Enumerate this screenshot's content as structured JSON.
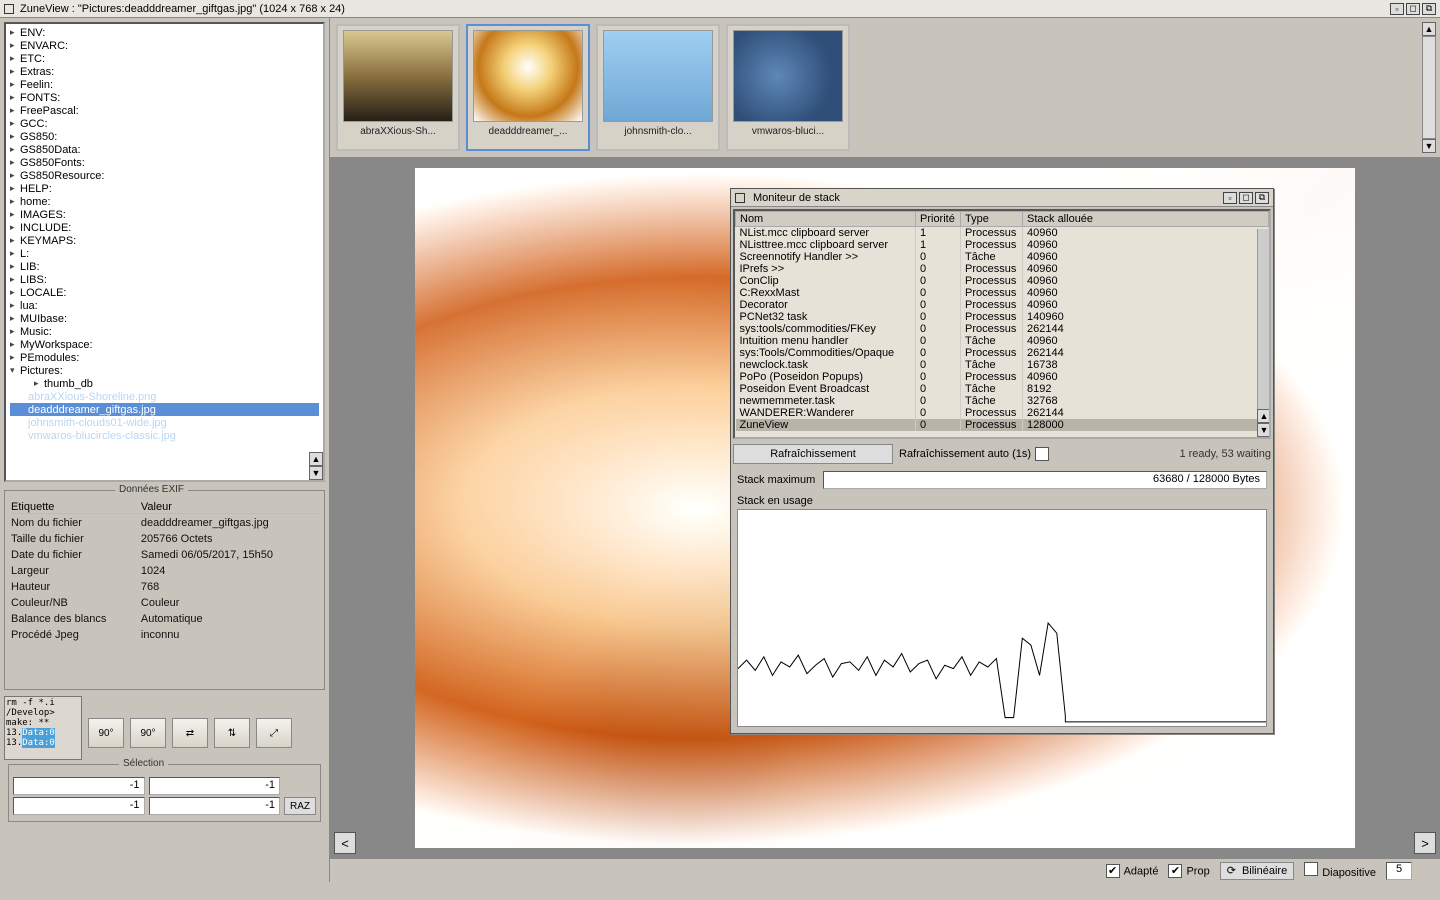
{
  "title": "ZuneView : \"Pictures:deadddreamer_giftgas.jpg\" (1024 x 768 x 24)",
  "tree": {
    "items": [
      "ENV:",
      "ENVARC:",
      "ETC:",
      "Extras:",
      "Feelin:",
      "FONTS:",
      "FreePascal:",
      "GCC:",
      "GS850:",
      "GS850Data:",
      "GS850Fonts:",
      "GS850Resource:",
      "HELP:",
      "home:",
      "IMAGES:",
      "INCLUDE:",
      "KEYMAPS:",
      "L:",
      "LIB:",
      "LIBS:",
      "LOCALE:",
      "lua:",
      "MUIbase:",
      "Music:",
      "MyWorkspace:",
      "PEmodules:"
    ],
    "open": "Pictures:",
    "children": [
      {
        "label": "thumb_db",
        "type": "dir"
      },
      {
        "label": "abraXXious-Shoreline.png",
        "type": "ghost"
      },
      {
        "label": "deadddreamer_giftgas.jpg",
        "type": "sel"
      },
      {
        "label": "johnsmith-clouds01-wide.jpg",
        "type": "ghost"
      },
      {
        "label": "vmwaros-blucircles-classic.jpg",
        "type": "ghost"
      }
    ]
  },
  "exif": {
    "legend": "Données EXIF",
    "headers": [
      "Etiquette",
      "Valeur"
    ],
    "rows": [
      [
        "Nom du fichier",
        "deadddreamer_giftgas.jpg"
      ],
      [
        "Taille du fichier",
        "205766 Octets"
      ],
      [
        "Date du fichier",
        "Samedi 06/05/2017, 15h50"
      ],
      [
        "Largeur",
        "1024"
      ],
      [
        "Hauteur",
        "768"
      ],
      [
        "Couleur/NB",
        "Couleur"
      ],
      [
        "Balance des blancs",
        "Automatique"
      ],
      [
        "Procédé Jpeg",
        "inconnu"
      ]
    ]
  },
  "tools": {
    "rotate_ccw": "90°",
    "rotate_cw": "90°",
    "selection_legend": "Sélection",
    "sel_values": [
      "-1",
      "-1",
      "-1",
      "-1"
    ],
    "raz": "RAZ",
    "term_lines": [
      "rm -f *.i",
      "/Develop>",
      "make: **",
      "13.",
      "13."
    ],
    "term_tag": "Data:0"
  },
  "thumbs": [
    {
      "label": "abraXXious-Sh..."
    },
    {
      "label": "deadddreamer_...",
      "sel": true
    },
    {
      "label": "johnsmith-clo..."
    },
    {
      "label": "vmwaros-bluci..."
    }
  ],
  "bottom": {
    "adapt": "Adapté",
    "prop": "Prop",
    "filter": "Bilinéaire",
    "slide": "Diapositive",
    "slide_val": "5"
  },
  "stack": {
    "title": "Moniteur de stack",
    "headers": [
      "Nom",
      "Priorité",
      "Type",
      "Stack allouée"
    ],
    "rows": [
      [
        "NList.mcc clipboard server",
        "1",
        "Processus",
        "40960"
      ],
      [
        "NListtree.mcc clipboard server",
        "1",
        "Processus",
        "40960"
      ],
      [
        "Screennotify Handler >>",
        "0",
        "Tâche",
        "40960"
      ],
      [
        "IPrefs >>",
        "0",
        "Processus",
        "40960"
      ],
      [
        "ConClip",
        "0",
        "Processus",
        "40960"
      ],
      [
        "C:RexxMast",
        "0",
        "Processus",
        "40960"
      ],
      [
        "Decorator",
        "0",
        "Processus",
        "40960"
      ],
      [
        "PCNet32 task",
        "0",
        "Processus",
        "140960"
      ],
      [
        "sys:tools/commodities/FKey",
        "0",
        "Processus",
        "262144"
      ],
      [
        "Intuition menu handler",
        "0",
        "Tâche",
        "40960"
      ],
      [
        "sys:Tools/Commodities/Opaque",
        "0",
        "Processus",
        "262144"
      ],
      [
        "newclock.task",
        "0",
        "Tâche",
        "16738"
      ],
      [
        "PoPo (Poseidon Popups)",
        "0",
        "Processus",
        "40960"
      ],
      [
        "Poseidon Event Broadcast",
        "0",
        "Tâche",
        "8192"
      ],
      [
        "newmemmeter.task",
        "0",
        "Tâche",
        "32768"
      ],
      [
        "WANDERER:Wanderer",
        "0",
        "Processus",
        "262144"
      ],
      [
        "ZuneView",
        "0",
        "Processus",
        "128000"
      ]
    ],
    "refresh_btn": "Rafraîchissement",
    "auto_label": "Rafraîchissement auto (1s)",
    "status_right": "1 ready, 53 waiting",
    "max_label": "Stack maximum",
    "max_value": "63680 / 128000 Bytes",
    "usage_label": "Stack en usage"
  },
  "chart_data": {
    "type": "line",
    "title": "Stack en usage",
    "xlabel": "",
    "ylabel": "",
    "ylim": [
      0,
      128000
    ],
    "x": [
      0,
      2,
      4,
      6,
      8,
      10,
      12,
      14,
      16,
      18,
      20,
      22,
      24,
      26,
      28,
      30,
      32,
      34,
      36,
      38,
      40,
      42,
      44,
      46,
      48,
      50,
      52,
      54,
      56,
      58,
      60,
      62,
      64,
      66,
      68,
      70,
      72,
      74,
      76
    ],
    "values": [
      34000,
      39000,
      33000,
      41000,
      30000,
      38000,
      35000,
      42000,
      31000,
      36000,
      40000,
      29000,
      37000,
      38000,
      33000,
      41000,
      30000,
      39000,
      35000,
      43000,
      32000,
      37000,
      39000,
      28000,
      36000,
      34000,
      41000,
      30000,
      38000,
      35000,
      40000,
      5000,
      5000,
      52000,
      48000,
      30000,
      61000,
      55000,
      6000
    ]
  }
}
